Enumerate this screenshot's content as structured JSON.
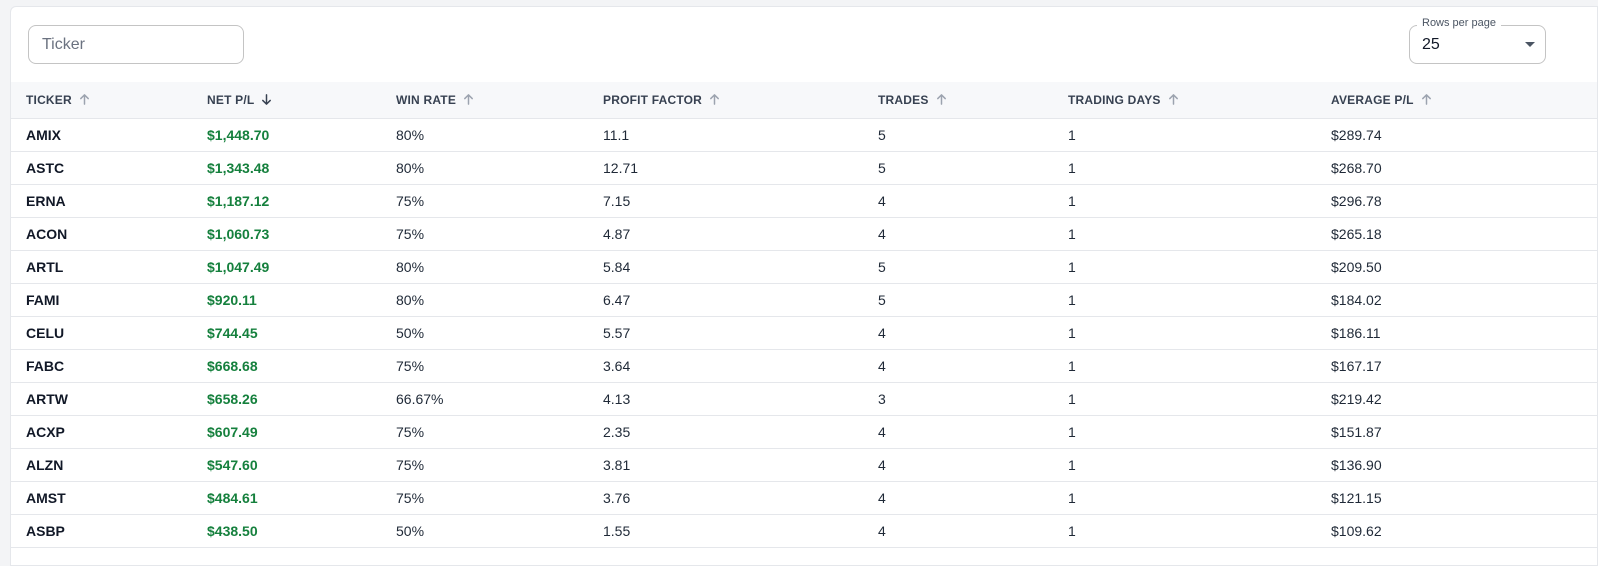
{
  "filter": {
    "ticker_placeholder": "Ticker",
    "ticker_value": ""
  },
  "rows_per_page": {
    "label": "Rows per page",
    "value": "25"
  },
  "table": {
    "columns": [
      {
        "label": "TICKER",
        "sort": "up-arrow-icon"
      },
      {
        "label": "NET P/L",
        "sort": "down-arrow-icon"
      },
      {
        "label": "WIN RATE",
        "sort": "up-arrow-icon"
      },
      {
        "label": "PROFIT FACTOR",
        "sort": "up-arrow-icon"
      },
      {
        "label": "TRADES",
        "sort": "up-arrow-icon"
      },
      {
        "label": "TRADING DAYS",
        "sort": "up-arrow-icon"
      },
      {
        "label": "AVERAGE P/L",
        "sort": "up-arrow-icon"
      }
    ],
    "rows": [
      [
        "AMIX",
        "$1,448.70",
        "80%",
        "11.1",
        "5",
        "1",
        "$289.74"
      ],
      [
        "ASTC",
        "$1,343.48",
        "80%",
        "12.71",
        "5",
        "1",
        "$268.70"
      ],
      [
        "ERNA",
        "$1,187.12",
        "75%",
        "7.15",
        "4",
        "1",
        "$296.78"
      ],
      [
        "ACON",
        "$1,060.73",
        "75%",
        "4.87",
        "4",
        "1",
        "$265.18"
      ],
      [
        "ARTL",
        "$1,047.49",
        "80%",
        "5.84",
        "5",
        "1",
        "$209.50"
      ],
      [
        "FAMI",
        "$920.11",
        "80%",
        "6.47",
        "5",
        "1",
        "$184.02"
      ],
      [
        "CELU",
        "$744.45",
        "50%",
        "5.57",
        "4",
        "1",
        "$186.11"
      ],
      [
        "FABC",
        "$668.68",
        "75%",
        "3.64",
        "4",
        "1",
        "$167.17"
      ],
      [
        "ARTW",
        "$658.26",
        "66.67%",
        "4.13",
        "3",
        "1",
        "$219.42"
      ],
      [
        "ACXP",
        "$607.49",
        "75%",
        "2.35",
        "4",
        "1",
        "$151.87"
      ],
      [
        "ALZN",
        "$547.60",
        "75%",
        "3.81",
        "4",
        "1",
        "$136.90"
      ],
      [
        "AMST",
        "$484.61",
        "75%",
        "3.76",
        "4",
        "1",
        "$121.15"
      ],
      [
        "ASBP",
        "$438.50",
        "50%",
        "1.55",
        "4",
        "1",
        "$109.62"
      ]
    ]
  },
  "colors": {
    "positive_pl": "#15803d",
    "header_bg": "#f7f8fa"
  }
}
